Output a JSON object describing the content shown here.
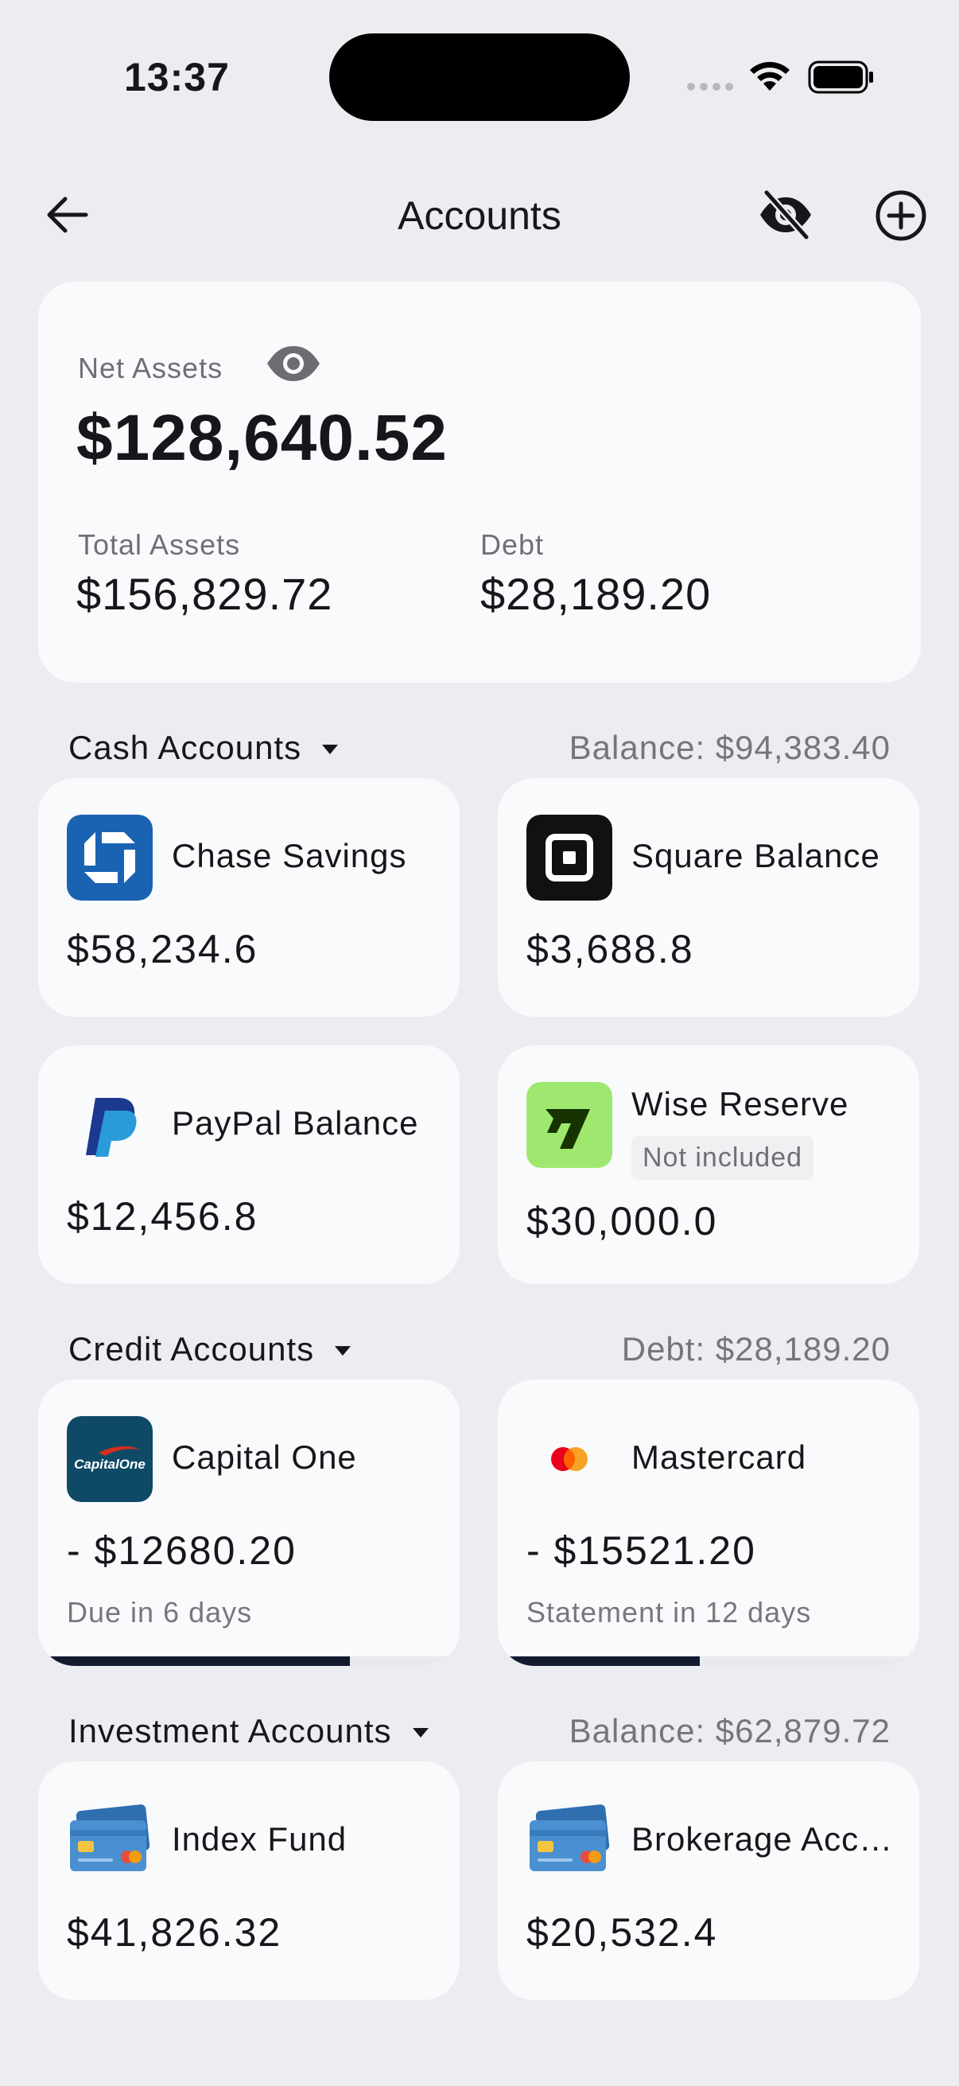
{
  "status": {
    "time": "13:37"
  },
  "header": {
    "title": "Accounts"
  },
  "summary": {
    "net_label": "Net Assets",
    "net_value": "$128,640.52",
    "total_label": "Total Assets",
    "total_value": "$156,829.72",
    "debt_label": "Debt",
    "debt_value": "$28,189.20"
  },
  "sections": [
    {
      "title": "Cash Accounts",
      "total": "Balance: $94,383.40",
      "accounts": [
        {
          "name": "Chase Savings",
          "amount": "$58,234.6",
          "logo": "chase-logo"
        },
        {
          "name": "Square Balance",
          "amount": "$3,688.8",
          "logo": "square-logo"
        },
        {
          "name": "PayPal Balance",
          "amount": "$12,456.8",
          "logo": "paypal-logo"
        },
        {
          "name": "Wise Reserve",
          "amount": "$30,000.0",
          "badge": "Not included",
          "logo": "wise-logo"
        }
      ]
    },
    {
      "title": "Credit Accounts",
      "total": "Debt: $28,189.20",
      "accounts": [
        {
          "name": "Capital One",
          "amount": "- $12680.20",
          "note": "Due in 6 days",
          "progress": 0.74,
          "logo": "capital-one-logo"
        },
        {
          "name": "Mastercard",
          "amount": "- $15521.20",
          "note": "Statement in 12 days",
          "progress": 0.48,
          "logo": "mastercard-logo"
        }
      ]
    },
    {
      "title": "Investment Accounts",
      "total": "Balance: $62,879.72",
      "accounts": [
        {
          "name": "Index Fund",
          "amount": "$41,826.32",
          "logo": "credit-card-icon"
        },
        {
          "name": "Brokerage Acc…",
          "amount": "$20,532.4",
          "logo": "credit-card-icon"
        }
      ]
    }
  ],
  "colors": {
    "background": "#ecedf0",
    "card": "#f9fafb",
    "chase_blue": "#1a63b3",
    "wise_green": "#9fe870",
    "capital_one_navy": "#0e4a66",
    "progress": "#141a2e"
  }
}
